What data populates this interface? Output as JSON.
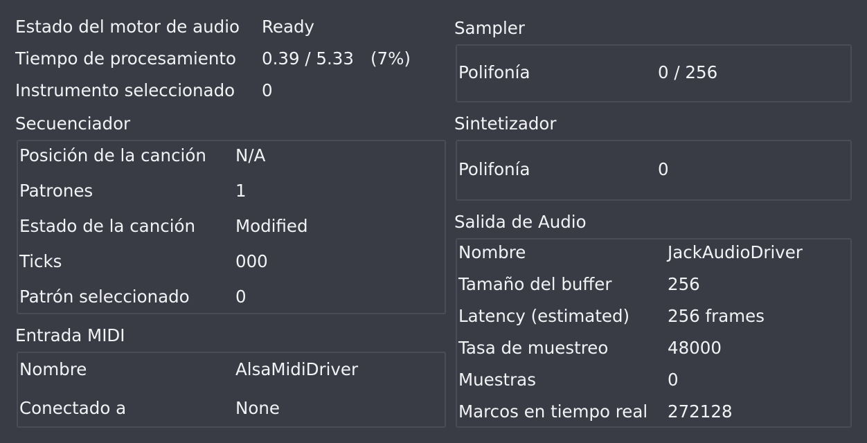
{
  "status": {
    "engine_label": "Estado del motor de audio",
    "engine_value": "Ready",
    "process_label": "Tiempo de procesamiento",
    "process_value": "0.39 / 5.33",
    "process_pct": "(7%)",
    "instrument_label": "Instrumento seleccionado",
    "instrument_value": "0"
  },
  "sequencer": {
    "title": "Secuenciador",
    "rows": [
      {
        "label": "Posición de la canción",
        "value": "N/A"
      },
      {
        "label": "Patrones",
        "value": "1"
      },
      {
        "label": "Estado de la canción",
        "value": "Modified"
      },
      {
        "label": "Ticks",
        "value": "000"
      },
      {
        "label": "Patrón seleccionado",
        "value": "0"
      }
    ]
  },
  "midi_input": {
    "title": "Entrada MIDI",
    "rows": [
      {
        "label": "Nombre",
        "value": "AlsaMidiDriver"
      },
      {
        "label": "Conectado a",
        "value": "None"
      }
    ]
  },
  "sampler": {
    "title": "Sampler",
    "polyphony_label": "Polifonía",
    "polyphony_value": "0 / 256"
  },
  "synth": {
    "title": "Sintetizador",
    "polyphony_label": "Polifonía",
    "polyphony_value": "0"
  },
  "audio_output": {
    "title": "Salida de Audio",
    "rows": [
      {
        "label": "Nombre",
        "value": "JackAudioDriver"
      },
      {
        "label": "Tamaño del buffer",
        "value": "256"
      },
      {
        "label": "Latency (estimated)",
        "value": "256 frames"
      },
      {
        "label": "Tasa de muestreo",
        "value": "48000"
      },
      {
        "label": "Muestras",
        "value": "0"
      },
      {
        "label": "Marcos en tiempo real",
        "value": "272128"
      }
    ]
  }
}
